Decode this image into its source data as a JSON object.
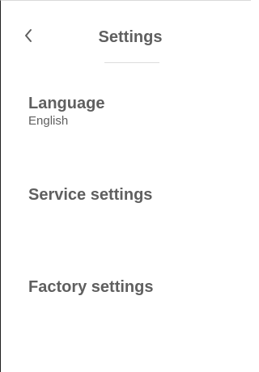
{
  "header": {
    "title": "Settings",
    "back_icon": "chevron-left-icon"
  },
  "settings": {
    "language": {
      "label": "Language",
      "value": "English"
    },
    "service": {
      "label": "Service settings"
    },
    "factory": {
      "label": "Factory settings"
    }
  },
  "colors": {
    "text": "#5f5f5f",
    "background": "#ffffff",
    "divider": "#dcdcdc"
  }
}
